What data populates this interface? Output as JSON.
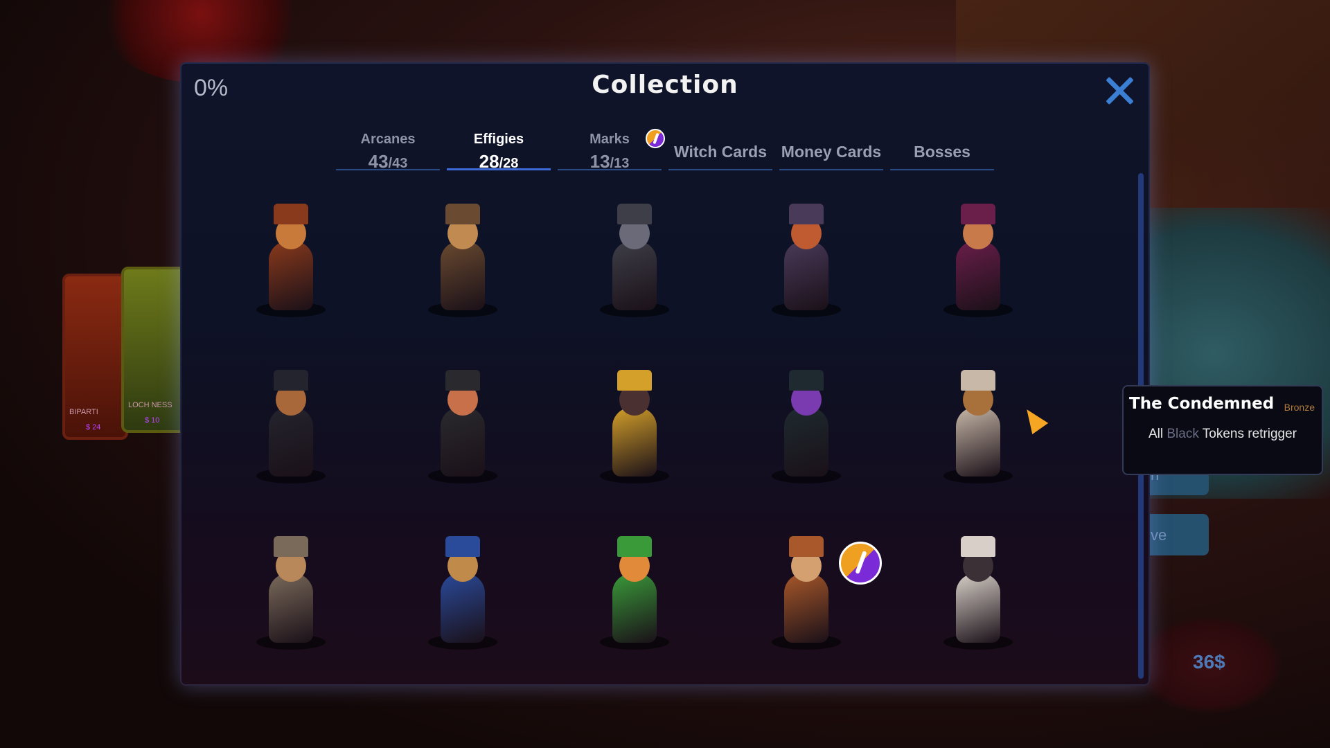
{
  "modal": {
    "percent": "0%",
    "title": "Collection"
  },
  "tabs": [
    {
      "name": "Arcanes",
      "count": "43",
      "total": "43",
      "active": false
    },
    {
      "name": "Effigies",
      "count": "28",
      "total": "28",
      "active": true
    },
    {
      "name": "Marks",
      "count": "13",
      "total": "13",
      "active": false,
      "badge": "new-alert-icon"
    },
    {
      "name": "Witch Cards",
      "active": false
    },
    {
      "name": "Money Cards",
      "active": false
    },
    {
      "name": "Bosses",
      "active": false
    }
  ],
  "effigies": [
    {
      "name": "bearded-man-effigy",
      "colors": [
        "#8a3a1c",
        "#c87a3a"
      ]
    },
    {
      "name": "hooded-woman-effigy",
      "colors": [
        "#6a4a30",
        "#c08a50"
      ]
    },
    {
      "name": "gargoyle-effigy",
      "colors": [
        "#3e3e48",
        "#6a6a78"
      ]
    },
    {
      "name": "top-hat-redhead-effigy",
      "colors": [
        "#4a3a5a",
        "#c05a30"
      ]
    },
    {
      "name": "smoking-woman-effigy",
      "colors": [
        "#6a1e4a",
        "#c87a4a"
      ]
    },
    {
      "name": "banjo-player-effigy",
      "colors": [
        "#24242e",
        "#a8683a"
      ]
    },
    {
      "name": "medusa-woman-effigy",
      "colors": [
        "#2a2a2e",
        "#c8704a"
      ]
    },
    {
      "name": "skull-mirror-effigy",
      "colors": [
        "#d4a02a",
        "#4a3030"
      ]
    },
    {
      "name": "hooded-shadow-effigy",
      "colors": [
        "#1e2a30",
        "#7a3ab0"
      ]
    },
    {
      "name": "the-condemned-effigy",
      "colors": [
        "#c8b8a8",
        "#a8703a"
      ]
    },
    {
      "name": "torch-bearer-effigy",
      "colors": [
        "#7a6a5a",
        "#b8885a"
      ]
    },
    {
      "name": "trumpet-player-effigy",
      "colors": [
        "#2a4a9a",
        "#c08a4a"
      ]
    },
    {
      "name": "bottled-creature-effigy",
      "colors": [
        "#3a9a3a",
        "#e08a3a"
      ]
    },
    {
      "name": "monkey-effigy",
      "colors": [
        "#a8582a",
        "#d4a070"
      ],
      "badge": "new-alert-icon"
    },
    {
      "name": "nurse-effigy",
      "colors": [
        "#d8d0c8",
        "#3a3036"
      ]
    }
  ],
  "tooltip": {
    "name": "The Condemned",
    "rarity": "Bronze",
    "desc_pre": "All ",
    "desc_highlight": "Black",
    "desc_post": " Tokens retrigger"
  },
  "background": {
    "card1_label": "BIPARTI",
    "card1_price": "$ 24",
    "card2_label": "LOCH NESS",
    "card2_price": "$ 10",
    "money": "36$",
    "cut_text_1": "n",
    "cut_text_2": "ve"
  },
  "colors": {
    "accent": "#3d6ad6",
    "close": "#3b7fd4",
    "rarity_bronze": "#b07a3a"
  }
}
